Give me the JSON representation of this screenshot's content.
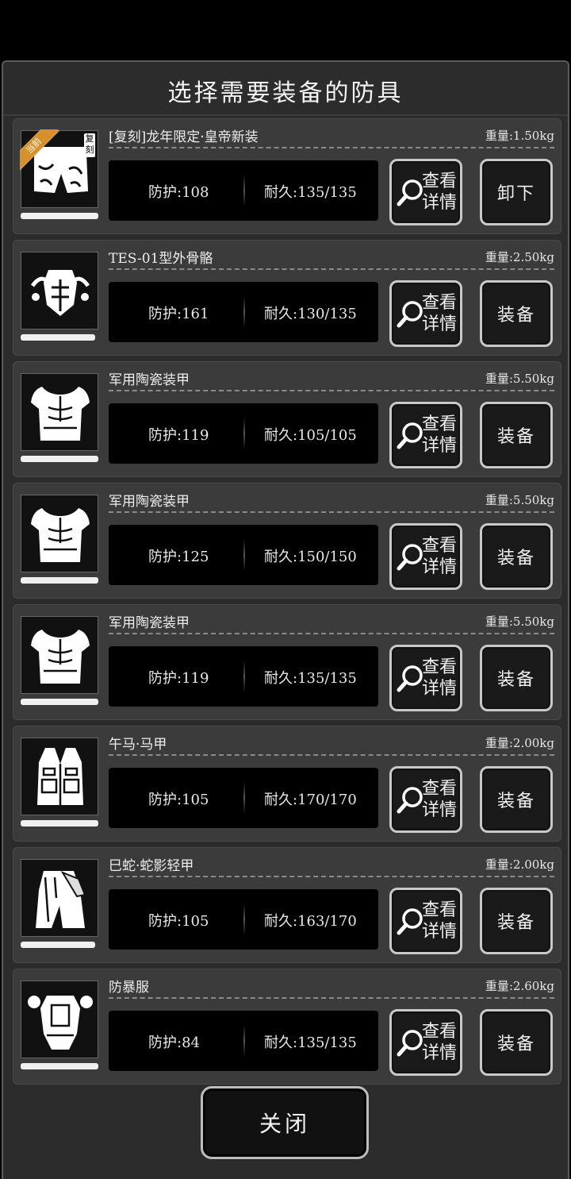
{
  "title": "选择需要装备的防具",
  "close_label": "关闭",
  "detail_label": "查看详情",
  "badges": {
    "current": "当前",
    "copy": "复刻"
  },
  "items": [
    {
      "name": "[复刻]龙年限定·皇帝新装",
      "weight": "重量:1.50kg",
      "defense": "防护:108",
      "durability": "耐久:135/135",
      "action": "卸下",
      "icon": "pants-icon",
      "durability_fill": 1.0
    },
    {
      "name": "TES-01型外骨骼",
      "weight": "重量:2.50kg",
      "defense": "防护:161",
      "durability": "耐久:130/135",
      "action": "装备",
      "icon": "exoskeleton-icon",
      "durability_fill": 0.96
    },
    {
      "name": "军用陶瓷装甲",
      "weight": "重量:5.50kg",
      "defense": "防护:119",
      "durability": "耐久:105/105",
      "action": "装备",
      "icon": "armor-vest-icon",
      "durability_fill": 1.0
    },
    {
      "name": "军用陶瓷装甲",
      "weight": "重量:5.50kg",
      "defense": "防护:125",
      "durability": "耐久:150/150",
      "action": "装备",
      "icon": "armor-vest-icon",
      "durability_fill": 1.0
    },
    {
      "name": "军用陶瓷装甲",
      "weight": "重量:5.50kg",
      "defense": "防护:119",
      "durability": "耐久:135/135",
      "action": "装备",
      "icon": "armor-vest-icon",
      "durability_fill": 1.0
    },
    {
      "name": "午马·马甲",
      "weight": "重量:2.00kg",
      "defense": "防护:105",
      "durability": "耐久:170/170",
      "action": "装备",
      "icon": "tactical-vest-icon",
      "durability_fill": 1.0
    },
    {
      "name": "巳蛇·蛇影轻甲",
      "weight": "重量:2.00kg",
      "defense": "防护:105",
      "durability": "耐久:163/170",
      "action": "装备",
      "icon": "cloak-icon",
      "durability_fill": 0.96
    },
    {
      "name": "防暴服",
      "weight": "重量:2.60kg",
      "defense": "防护:84",
      "durability": "耐久:135/135",
      "action": "装备",
      "icon": "riot-suit-icon",
      "durability_fill": 1.0
    }
  ]
}
